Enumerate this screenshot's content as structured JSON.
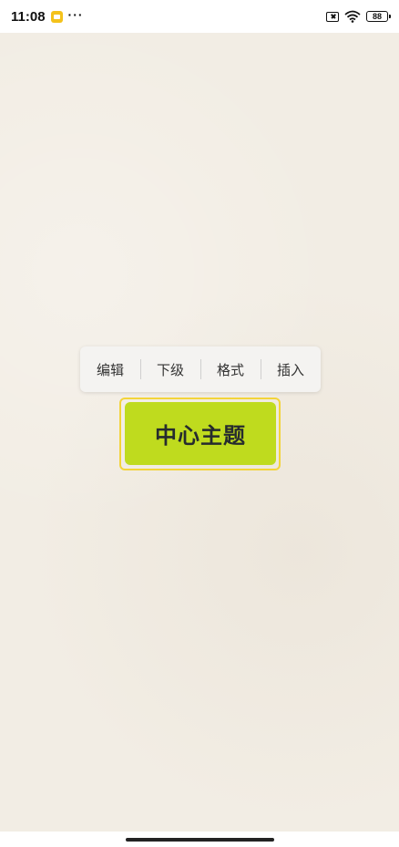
{
  "status_bar": {
    "time": "11:08",
    "dots": "···",
    "battery": "88",
    "icons": [
      "app-notification-icon",
      "no-sim-icon",
      "wifi-icon",
      "battery-icon"
    ]
  },
  "context_menu": {
    "items": [
      {
        "label": "编辑"
      },
      {
        "label": "下级"
      },
      {
        "label": "格式"
      },
      {
        "label": "插入"
      }
    ]
  },
  "mindmap": {
    "central_topic": "中心主题"
  },
  "colors": {
    "background": "#f2ede4",
    "topic_fill": "#bfdb1e",
    "selection_outline": "#f3d43a",
    "menu_bg": "#f4f3f1"
  }
}
